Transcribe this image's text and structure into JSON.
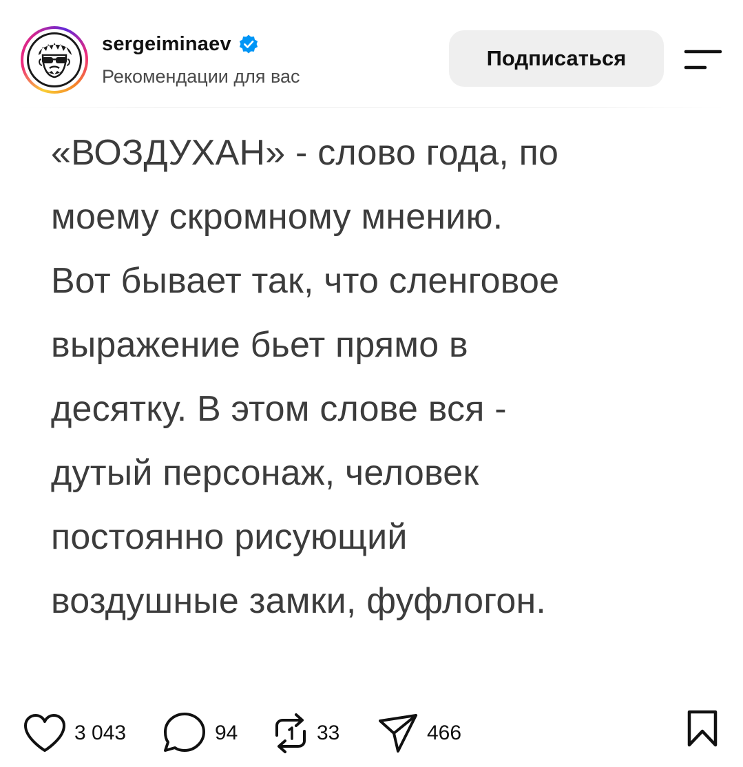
{
  "header": {
    "username": "sergeiminaev",
    "subtitle": "Рекомендации для вас",
    "follow_label": "Подписаться"
  },
  "post": {
    "lines": [
      "«ВОЗДУХАН» - слово года, по",
      "моему скромному мнению.",
      "Вот бывает так, что сленговое",
      "выражение бьет прямо в",
      "десятку. В этом слове вся -",
      "дутый персонаж, человек",
      "постоянно рисующий",
      "воздушные замки, фуфлогон."
    ]
  },
  "actions": {
    "likes": "3 043",
    "comments": "94",
    "reposts": "33",
    "shares": "466"
  },
  "icons": {
    "verified": "verified-badge-icon",
    "menu": "menu-icon",
    "like": "heart-icon",
    "comment": "comment-icon",
    "repost": "repost-icon",
    "share": "send-icon",
    "save": "bookmark-icon"
  },
  "colors": {
    "verified": "#0095f6",
    "button_bg": "#efefef",
    "text": "#3c3c3c"
  }
}
